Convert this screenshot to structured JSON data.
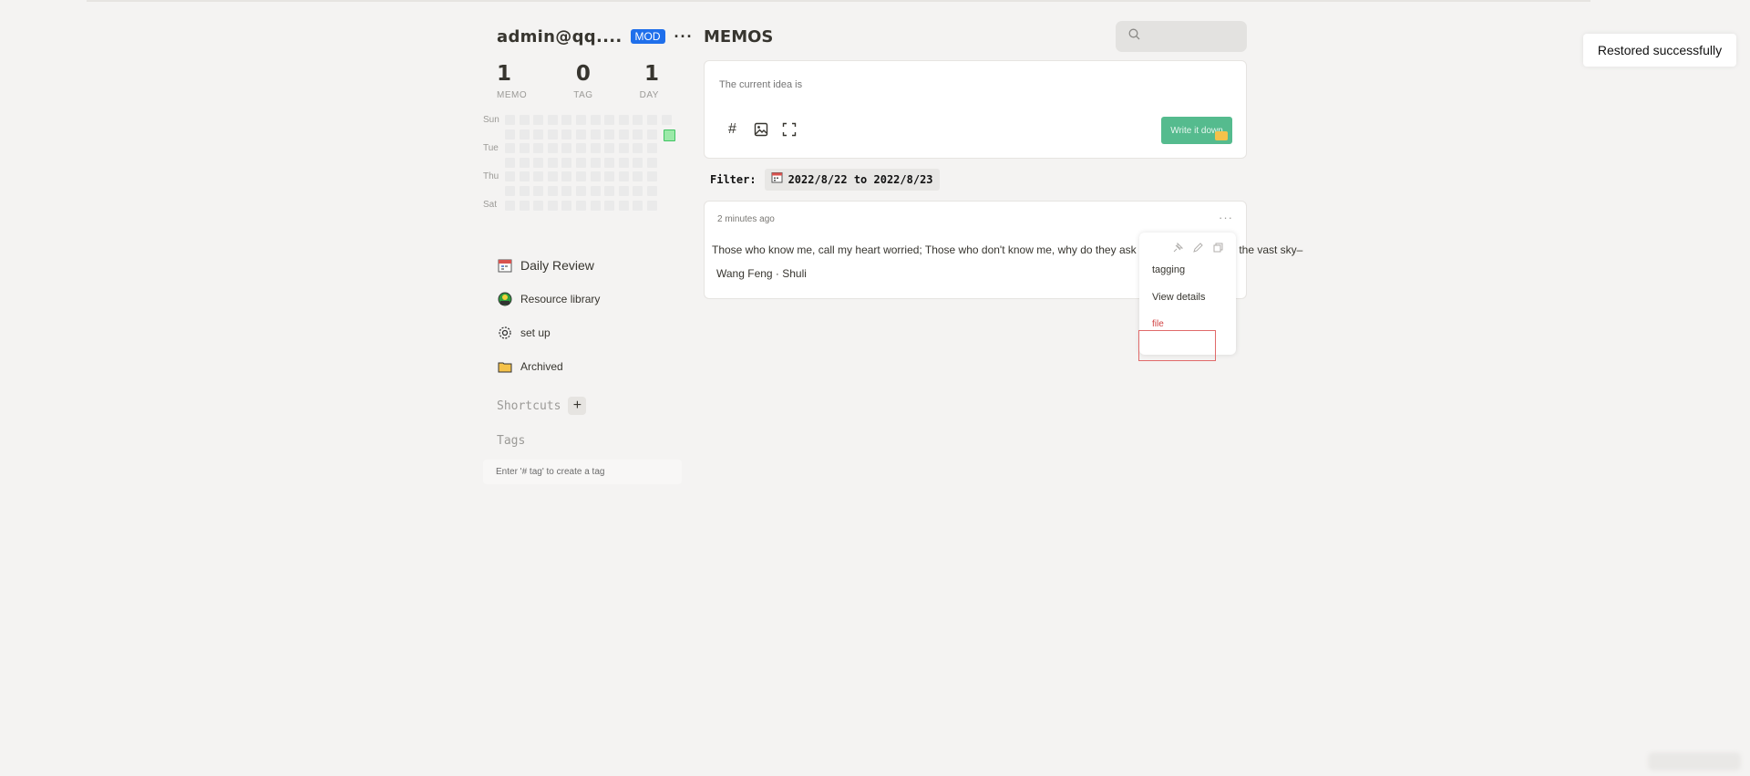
{
  "sidebar": {
    "username": "admin@qq....",
    "role_badge": "MOD",
    "more_label": "···",
    "stats": [
      {
        "value": "1",
        "label": "MEMO"
      },
      {
        "value": "0",
        "label": "TAG"
      },
      {
        "value": "1",
        "label": "DAY"
      }
    ],
    "heatmap": {
      "weekdays": [
        "Sun",
        "Tue",
        "Thu",
        "Sat"
      ],
      "weeks": 12
    },
    "nav": [
      {
        "label": "Daily Review",
        "icon": "calendar-icon"
      },
      {
        "label": "Resource library",
        "icon": "resource-icon"
      },
      {
        "label": "set up",
        "icon": "gear-icon"
      },
      {
        "label": "Archived",
        "icon": "folder-icon"
      }
    ],
    "shortcuts_title": "Shortcuts",
    "shortcuts_add": "+",
    "tags_title": "Tags",
    "tags_hint": "Enter '# tag' to create a tag"
  },
  "main": {
    "title": "MEMOS",
    "search_placeholder": "",
    "editor": {
      "placeholder": "The current idea is",
      "submit_label": "Write it down"
    },
    "filter": {
      "label": "Filter:",
      "value": "2022/8/22 to 2022/8/23"
    },
    "memo": {
      "time": "2 minutes ago",
      "more": "···",
      "line1": "Those who know me, call my heart worried; Those who don't know me, why do they ask for me? Who is this, the vast sky–",
      "line2": "Wang Feng · Shuli"
    },
    "menu": {
      "items": [
        "tagging",
        "View details",
        "file"
      ]
    }
  },
  "toast": {
    "message": "Restored successfully"
  },
  "colors": {
    "background": "#f4f3f2",
    "accent_green": "#55bb8e",
    "badge_blue": "#1f6feb",
    "danger_red": "#d14343"
  }
}
